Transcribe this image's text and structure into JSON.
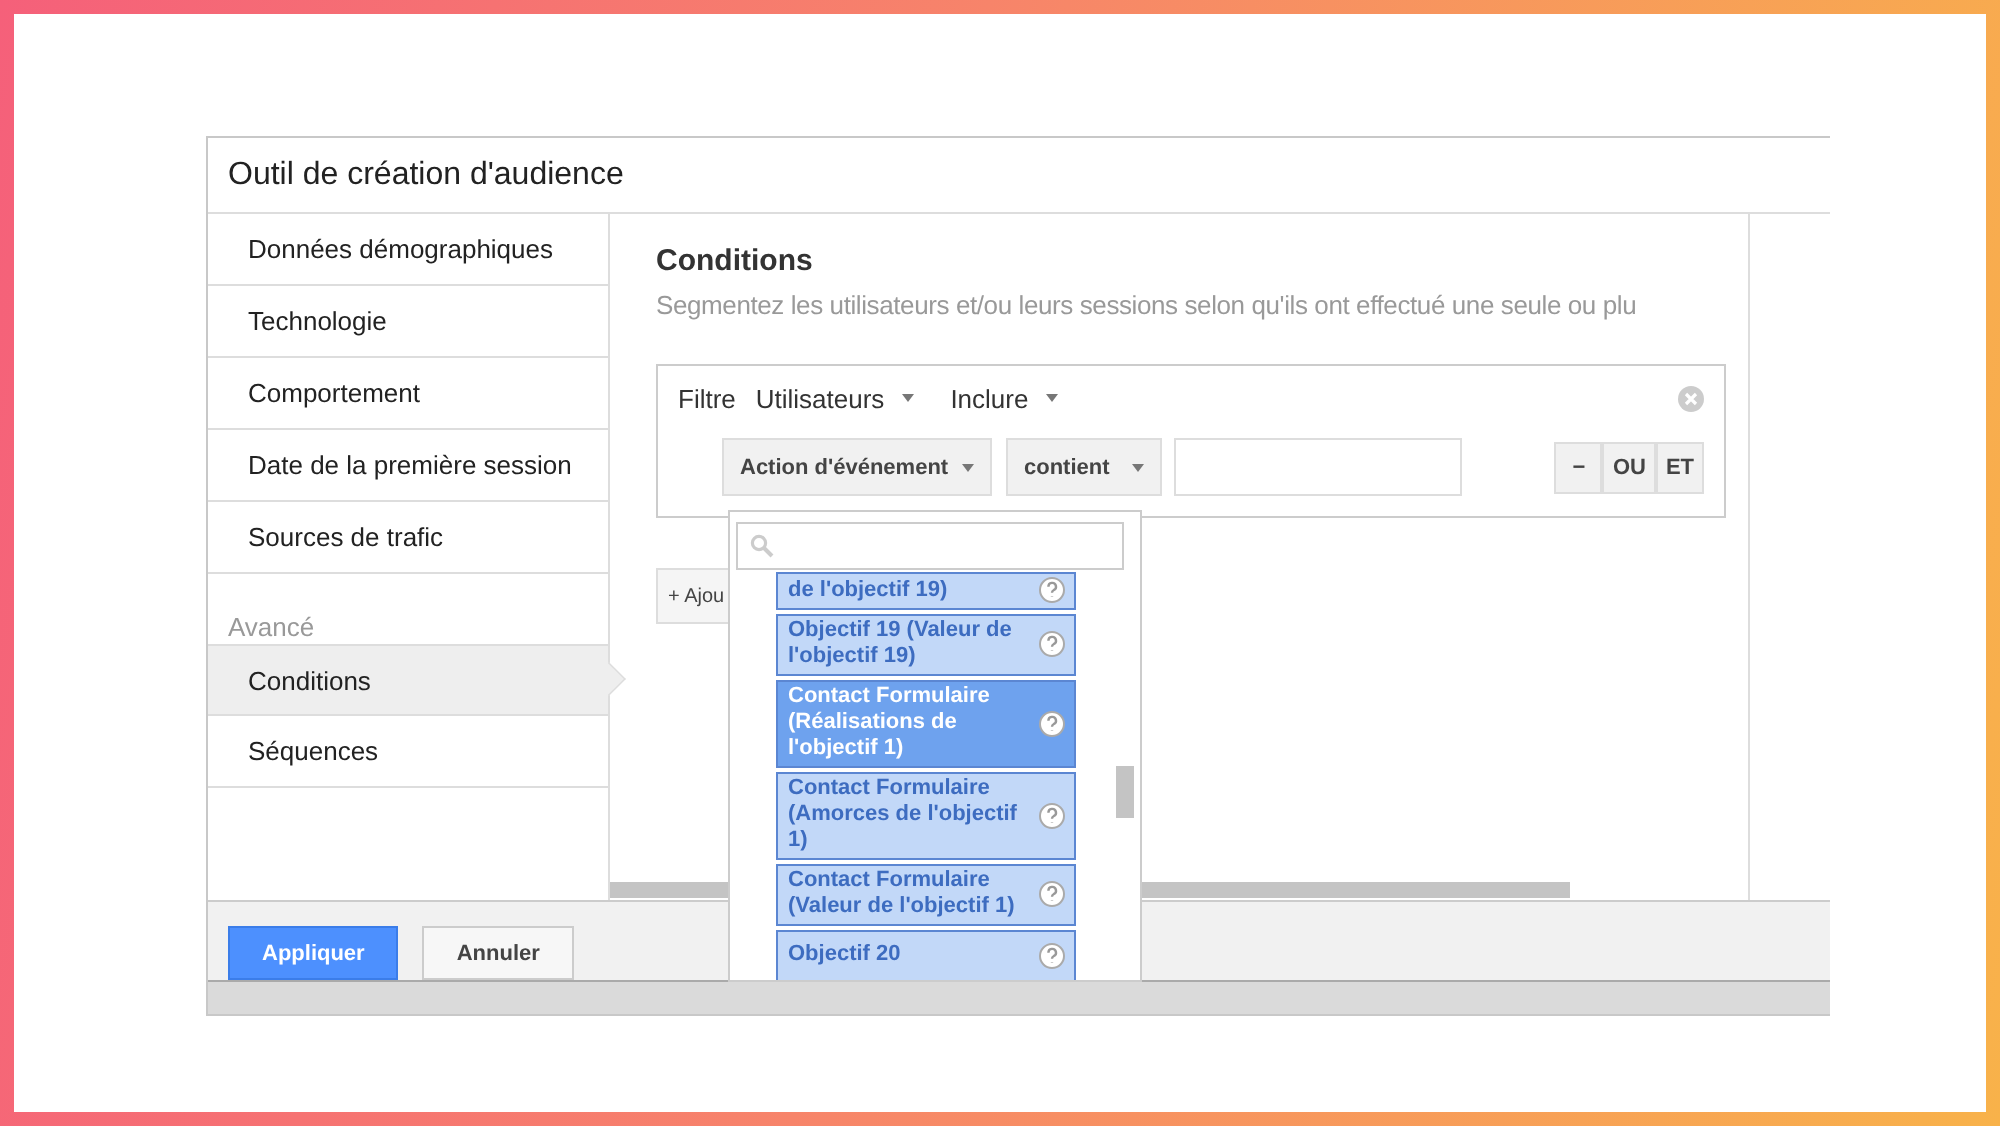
{
  "window": {
    "title": "Outil de création d'audience"
  },
  "sidebar": {
    "items": [
      {
        "label": "Données démographiques",
        "selected": false
      },
      {
        "label": "Technologie",
        "selected": false
      },
      {
        "label": "Comportement",
        "selected": false
      },
      {
        "label": "Date de la première session",
        "selected": false
      },
      {
        "label": "Sources de trafic",
        "selected": false
      }
    ],
    "section_label": "Avancé",
    "advanced_items": [
      {
        "label": "Conditions",
        "selected": true
      },
      {
        "label": "Séquences",
        "selected": false
      }
    ]
  },
  "main": {
    "title": "Conditions",
    "description": "Segmentez les utilisateurs et/ou leurs sessions selon qu'ils ont effectué une seule ou plu",
    "filter": {
      "label": "Filtre",
      "scope": "Utilisateurs",
      "mode": "Inclure",
      "dimension": "Action d'événement",
      "operator": "contient",
      "logic_buttons": [
        "−",
        "OU",
        "ET"
      ]
    },
    "add_button": "+ Ajou"
  },
  "dropdown": {
    "items": [
      {
        "label": "de l'objectif 19)",
        "selected": false
      },
      {
        "label": "Objectif 19 (Valeur de l'objectif 19)",
        "selected": false
      },
      {
        "label": "Contact Formulaire (Réalisations de l'objectif 1)",
        "selected": true
      },
      {
        "label": "Contact Formulaire (Amorces de l'objectif 1)",
        "selected": false
      },
      {
        "label": "Contact Formulaire (Valeur de l'objectif 1)",
        "selected": false
      },
      {
        "label": "Objectif 20",
        "selected": false
      }
    ]
  },
  "footer": {
    "buttons": [
      {
        "label": "Appliquer",
        "kind": "primary"
      },
      {
        "label": "Annuler",
        "kind": "secondary"
      }
    ]
  }
}
